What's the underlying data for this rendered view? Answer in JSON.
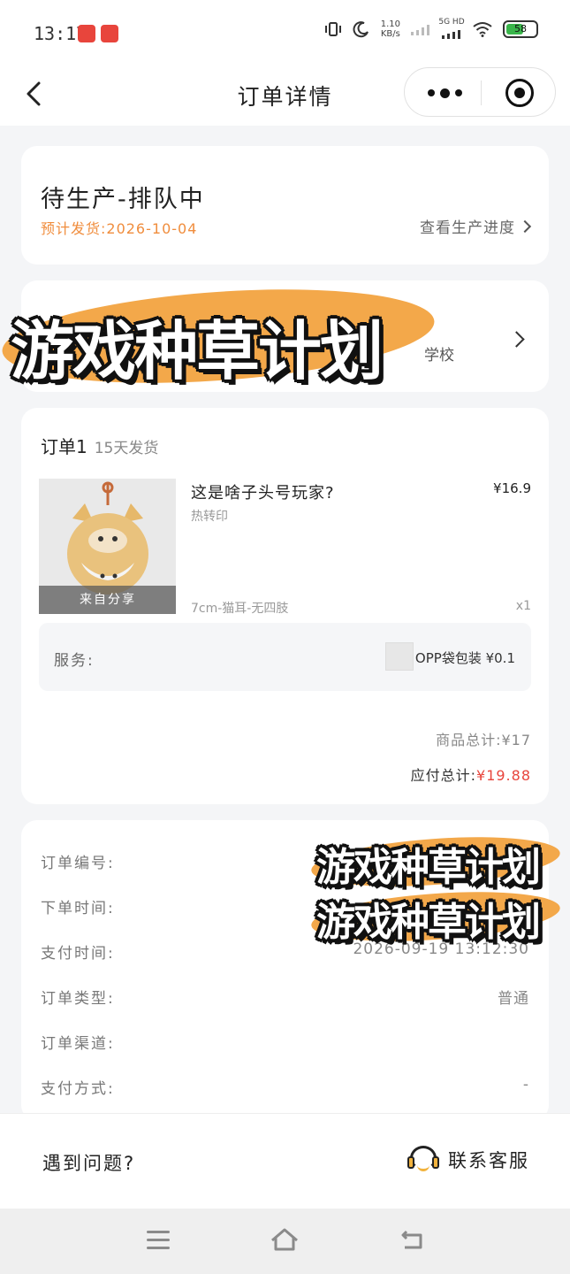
{
  "status_bar": {
    "time": "13:17",
    "net_speed_value": "1.10",
    "net_speed_unit": "KB/s",
    "network_label": "5G HD",
    "battery_level": "58",
    "app_icon_colors": [
      "#e8453c",
      "#e8453c"
    ]
  },
  "nav": {
    "title": "订单详情"
  },
  "status_card": {
    "title": "待生产-排队中",
    "eta": "预计发货:2026-10-04",
    "progress_link": "查看生产进度"
  },
  "address_card": {
    "school_fragment": "学校"
  },
  "order": {
    "header": "订单1",
    "ship_time": "15天发货",
    "product": {
      "name": "这是啥子头号玩家?",
      "price": "¥16.9",
      "craft": "热转印",
      "spec": "7cm-猫耳-无四肢",
      "qty": "x1",
      "thumb_tag": "来自分享"
    },
    "service": {
      "label": "服务:",
      "item": "OPP袋包装 ¥0.1"
    },
    "subtotal": "商品总计:¥17",
    "total_label": "应付总计:",
    "total_amount": "¥19.88"
  },
  "info": {
    "rows": [
      {
        "label": "订单编号:",
        "value": ""
      },
      {
        "label": "下单时间:",
        "value": ""
      },
      {
        "label": "支付时间:",
        "value": "2026-09-19 13:12:30"
      },
      {
        "label": "订单类型:",
        "value": "普通"
      },
      {
        "label": "订单渠道:",
        "value": ""
      },
      {
        "label": "支付方式:",
        "value": "-"
      }
    ]
  },
  "bottom_bar": {
    "issue": "遇到问题?",
    "contact": "联系客服"
  },
  "watermarks": {
    "text": "游戏种草计划",
    "color": "#f3a84a"
  },
  "colors": {
    "accent_orange": "#f08d3d",
    "price_red": "#e8453c",
    "background": "#f4f5f7"
  }
}
